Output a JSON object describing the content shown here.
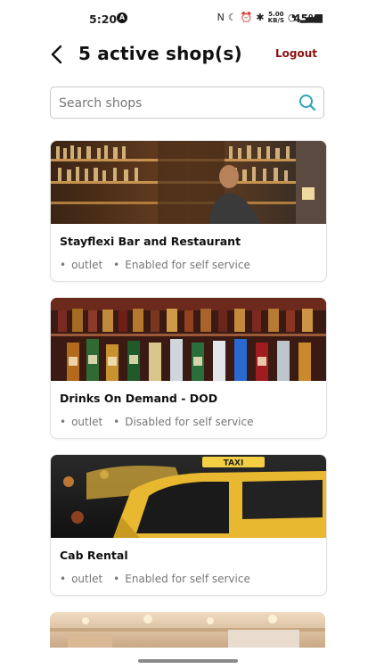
{
  "status_bar": {
    "time": "5:20",
    "network_speed": "5.00\nKB/S",
    "battery": "45%"
  },
  "header": {
    "title": "5 active shop(s)",
    "logout_label": "Logout"
  },
  "search": {
    "placeholder": "Search shops",
    "value": ""
  },
  "shops": [
    {
      "name": "Stayflexi Bar and Restaurant",
      "type": "outlet",
      "service": "Enabled for self service",
      "image": "bar-bartender-image"
    },
    {
      "name": "Drinks On Demand - DOD",
      "type": "outlet",
      "service": "Disabled for self service",
      "image": "liquor-bottles-image"
    },
    {
      "name": "Cab Rental",
      "type": "outlet",
      "service": "Enabled for self service",
      "image": "taxi-image"
    }
  ],
  "colors": {
    "accent": "#8a1010",
    "search_icon": "#2aa6b8",
    "text_muted": "#777777"
  }
}
